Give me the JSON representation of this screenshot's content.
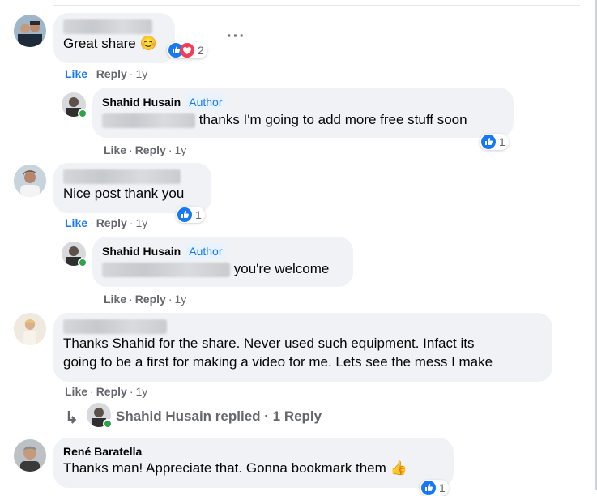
{
  "comments": [
    {
      "text": "Great share 😊",
      "reaction_count": "2",
      "actions": {
        "like": "Like",
        "reply": "Reply",
        "time": "1y"
      },
      "more_label": "···"
    },
    {
      "author": "Shahid Husain",
      "badge": "Author",
      "text": "thanks I'm going to add more free stuff soon",
      "reaction_count": "1",
      "actions": {
        "like": "Like",
        "reply": "Reply",
        "time": "1y"
      }
    },
    {
      "text": "Nice post thank you",
      "reaction_count": "1",
      "actions": {
        "like": "Like",
        "reply": "Reply",
        "time": "1y"
      }
    },
    {
      "author": "Shahid Husain",
      "badge": "Author",
      "text": "you're welcome",
      "actions": {
        "like": "Like",
        "reply": "Reply",
        "time": "1y"
      }
    },
    {
      "text_line1": "Thanks Shahid for the share. Never used such equipment. Infact its",
      "text_line2": "going to be a first for making a video for me. Lets see the mess I make",
      "actions": {
        "like": "Like",
        "reply": "Reply",
        "time": "1y"
      },
      "replied": {
        "arrow": "↳",
        "label": "Shahid Husain replied · 1 Reply"
      }
    },
    {
      "author": "René Baratella",
      "text": "Thanks man! Appreciate that. Gonna bookmark them 👍",
      "reaction_count": "1"
    }
  ],
  "colors": {
    "blue": "#1877f2",
    "bubble": "#f0f2f5",
    "muted": "#65676b",
    "love": "#f33e58"
  },
  "icons": [
    "like-reaction-icon",
    "love-reaction-icon",
    "more-options-icon",
    "reply-arrow-icon"
  ]
}
